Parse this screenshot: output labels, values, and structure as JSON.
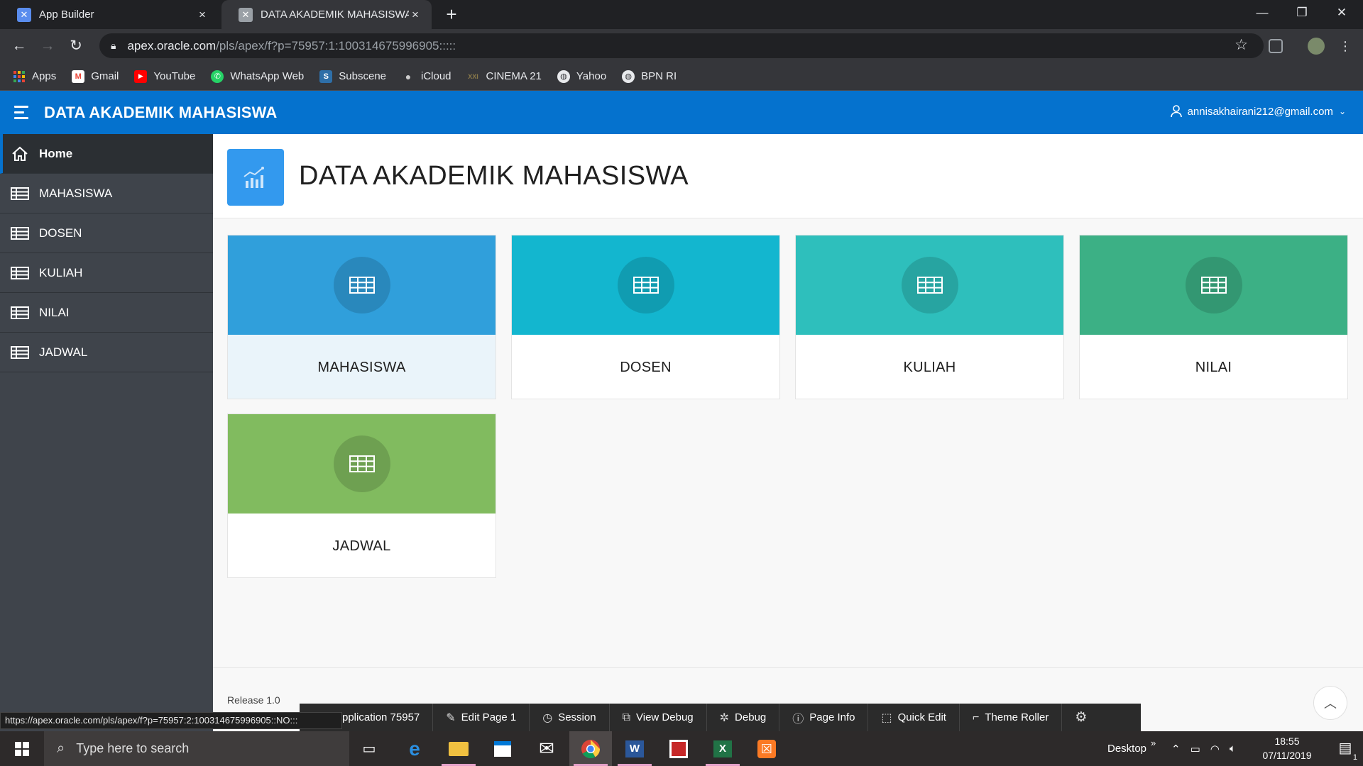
{
  "browser": {
    "tabs": [
      {
        "title": "App Builder",
        "active": false
      },
      {
        "title": "DATA AKADEMIK MAHASISWA",
        "active": true
      }
    ],
    "url_host": "apex.oracle.com",
    "url_path": "/pls/apex/f?p=75957:1:100314675996905:::::",
    "bookmarks": [
      {
        "label": "Apps",
        "icon": "apps-grid-icon",
        "color": "#ea4335"
      },
      {
        "label": "Gmail",
        "icon": "gmail-icon",
        "color": "#ffffff"
      },
      {
        "label": "YouTube",
        "icon": "youtube-icon",
        "color": "#ff0000"
      },
      {
        "label": "WhatsApp Web",
        "icon": "whatsapp-icon",
        "color": "#25d366"
      },
      {
        "label": "Subscene",
        "icon": "subscene-icon",
        "color": "#2e6fa8"
      },
      {
        "label": "iCloud",
        "icon": "apple-icon",
        "color": "#cccccc"
      },
      {
        "label": "CINEMA 21",
        "icon": "cinema-icon",
        "color": "#8a7a4a"
      },
      {
        "label": "Yahoo",
        "icon": "globe-icon",
        "color": "#e8eaed"
      },
      {
        "label": "BPN RI",
        "icon": "globe-icon",
        "color": "#e8eaed"
      }
    ]
  },
  "app": {
    "title": "DATA AKADEMIK MAHASISWA",
    "user": "annisakhairani212@gmail.com",
    "accent": "#0572ce"
  },
  "nav": [
    {
      "label": "Home",
      "icon": "home-icon",
      "active": true
    },
    {
      "label": "MAHASISWA",
      "icon": "table-icon",
      "active": false
    },
    {
      "label": "DOSEN",
      "icon": "table-icon",
      "active": false
    },
    {
      "label": "KULIAH",
      "icon": "table-icon",
      "active": false
    },
    {
      "label": "NILAI",
      "icon": "table-icon",
      "active": false
    },
    {
      "label": "JADWAL",
      "icon": "table-icon",
      "active": false
    }
  ],
  "page": {
    "title": "DATA AKADEMIK MAHASISWA",
    "hero_icon": "chart-icon",
    "cards": [
      {
        "label": "MAHASISWA",
        "color": "#309fdb",
        "highlighted": true
      },
      {
        "label": "DOSEN",
        "color": "#13b6cf",
        "highlighted": false
      },
      {
        "label": "KULIAH",
        "color": "#2ebfbc",
        "highlighted": false
      },
      {
        "label": "NILAI",
        "color": "#3cb085",
        "highlighted": false
      },
      {
        "label": "JADWAL",
        "color": "#81bb5f",
        "highlighted": false
      }
    ],
    "release": "Release 1.0"
  },
  "devbar": [
    {
      "label": "pplication 75957",
      "icon": ""
    },
    {
      "label": "Edit Page 1",
      "icon": "edit-icon"
    },
    {
      "label": "Session",
      "icon": "clock-icon"
    },
    {
      "label": "View Debug",
      "icon": "view-debug-icon"
    },
    {
      "label": "Debug",
      "icon": "bug-icon"
    },
    {
      "label": "Page Info",
      "icon": "info-icon"
    },
    {
      "label": "Quick Edit",
      "icon": "quick-edit-icon"
    },
    {
      "label": "Theme Roller",
      "icon": "paint-roller-icon"
    },
    {
      "label": "",
      "icon": "gear-icon"
    }
  ],
  "status_url": "https://apex.oracle.com/pls/apex/f?p=75957:2:100314675996905::NO:::",
  "taskbar": {
    "search_placeholder": "Type here to search",
    "desktop_label": "Desktop",
    "time": "18:55",
    "date": "07/11/2019",
    "notification_count": "1"
  }
}
